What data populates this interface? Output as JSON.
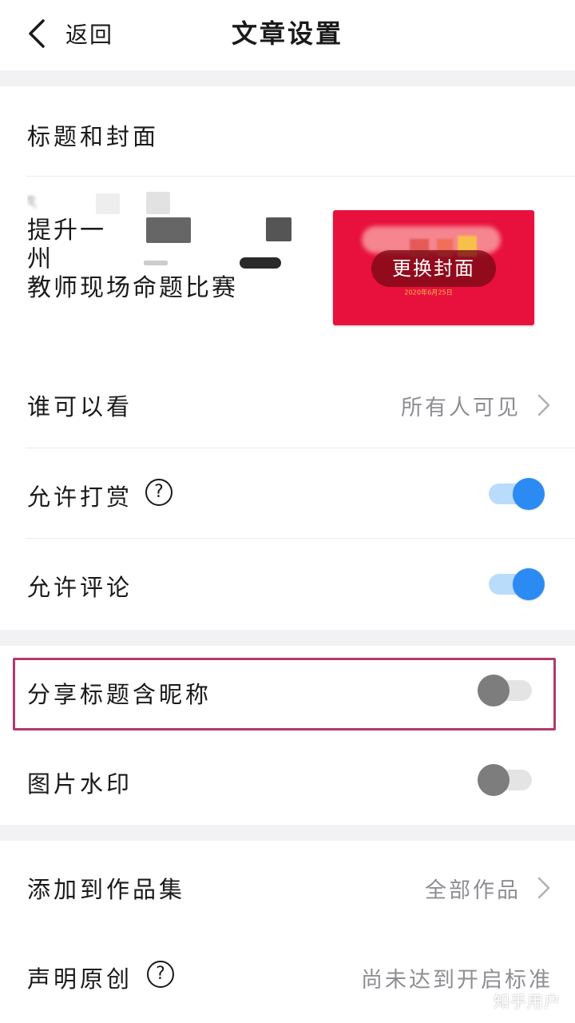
{
  "header": {
    "back_label": "返回",
    "title": "文章设置"
  },
  "title_cover": {
    "section_label": "标题和封面",
    "title_lines": [
      "提升一",
      "州",
      "教师现场命题比赛"
    ],
    "cover_button_label": "更换封面",
    "cover_caption": "2020年6月25日"
  },
  "settings": {
    "visibility": {
      "label": "谁可以看",
      "value": "所有人可见"
    },
    "allow_tips": {
      "label": "允许打赏",
      "help": "?",
      "enabled": true
    },
    "allow_comments": {
      "label": "允许评论",
      "enabled": true
    },
    "share_title_nickname": {
      "label": "分享标题含昵称",
      "enabled": false
    },
    "image_watermark": {
      "label": "图片水印",
      "enabled": false
    },
    "add_to_collection": {
      "label": "添加到作品集",
      "value": "全部作品"
    },
    "declare_original": {
      "label": "声明原创",
      "help": "?",
      "value": "尚未达到开启标准"
    }
  },
  "watermark": "知乎用户",
  "colors": {
    "toggle_on": "#2c8bf2",
    "toggle_off": "#7d7d7d",
    "highlight_border": "#b03a6e",
    "cover_bg": "#e8103c"
  }
}
